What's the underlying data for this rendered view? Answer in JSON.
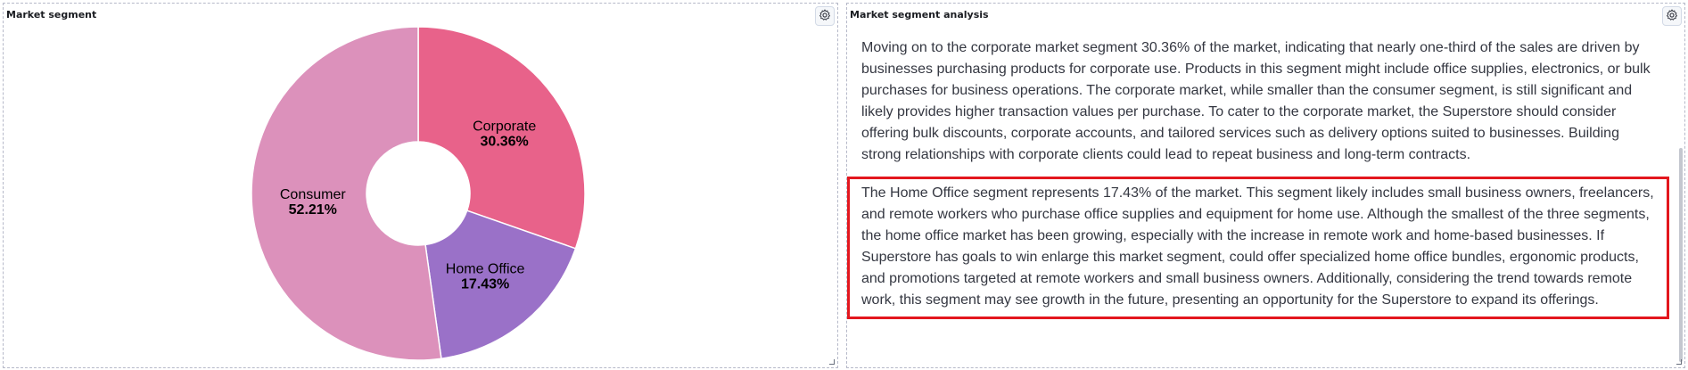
{
  "left_panel": {
    "title": "Market segment",
    "settings_icon": "gear-icon"
  },
  "right_panel": {
    "title": "Market segment analysis",
    "settings_icon": "gear-icon",
    "paragraphs": [
      "Moving on to the corporate market segment 30.36% of the market, indicating that nearly one-third of the sales are driven by businesses purchasing products for corporate use. Products in this segment might include office supplies, electronics, or bulk purchases for business operations. The corporate market, while smaller than the consumer segment, is still significant and likely provides higher transaction values per purchase. To cater to the corporate market, the Superstore should consider offering bulk discounts, corporate accounts, and tailored services such as delivery options suited to businesses. Building strong relationships with corporate clients could lead to repeat business and long-term contracts.",
      "The Home Office segment represents 17.43% of the market. This segment likely includes small business owners, freelancers, and remote workers who purchase office supplies and equipment for home use. Although the smallest of the three segments, the home office market has been growing, especially with the increase in remote work and home-based businesses. If Superstore has goals to win enlarge this market segment, could offer specialized home office bundles, ergonomic products, and promotions targeted at remote workers and small business owners. Additionally, considering the trend towards remote work, this segment may see growth in the future, presenting an opportunity for the Superstore to expand its offerings."
    ],
    "highlight_color": "#e3171e"
  },
  "chart_data": {
    "type": "pie",
    "donut": true,
    "title": "Market segment",
    "slices": [
      {
        "label": "Corporate",
        "value_label": "30.36%",
        "value": 30.36,
        "color": "#e8628a"
      },
      {
        "label": "Home Office",
        "value_label": "17.43%",
        "value": 17.43,
        "color": "#9a71c8"
      },
      {
        "label": "Consumer",
        "value_label": "52.21%",
        "value": 52.21,
        "color": "#dc91bb"
      }
    ],
    "start_angle": "12 o'clock",
    "direction": "clockwise"
  }
}
